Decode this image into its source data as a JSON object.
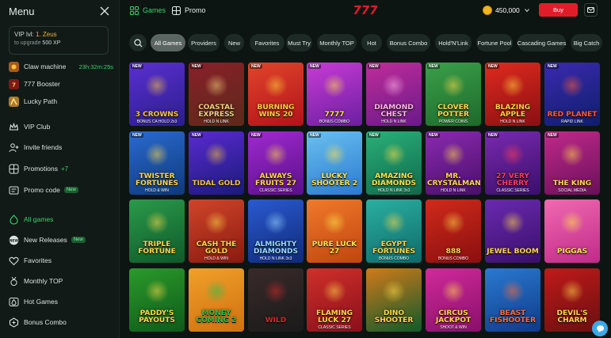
{
  "sidebar": {
    "menu_title": "Menu",
    "vip": {
      "label": "VIP lvl: ",
      "level": "1. Zeus",
      "upgrade_prefix": "to upgrade ",
      "upgrade_xp": "500 XP"
    },
    "items": [
      {
        "label": "Claw machine",
        "icon": "claw-machine-icon",
        "extra": "23h:32m:25s"
      },
      {
        "label": "777 Booster",
        "icon": "booster-icon"
      },
      {
        "label": "Lucky Path",
        "icon": "lucky-path-icon"
      },
      {
        "label": "VIP Club",
        "icon": "crown-icon"
      },
      {
        "label": "Invite friends",
        "icon": "invite-friends-icon"
      },
      {
        "label": "Promotions",
        "icon": "gift-icon",
        "extra": "+7"
      },
      {
        "label": "Promo code",
        "icon": "promo-code-icon",
        "extra": "New"
      },
      {
        "label": "All games",
        "icon": "all-games-icon"
      },
      {
        "label": "New Releases",
        "icon": "new-icon",
        "extra": "New"
      },
      {
        "label": "Favorites",
        "icon": "heart-icon"
      },
      {
        "label": "Monthly TOP",
        "icon": "medal-icon"
      },
      {
        "label": "Hot Games",
        "icon": "fire-icon"
      },
      {
        "label": "Bonus Combo",
        "icon": "bonus-combo-icon"
      }
    ]
  },
  "header": {
    "tabs": [
      {
        "label": "Games",
        "icon": "games-icon"
      },
      {
        "label": "Promo",
        "icon": "promo-icon"
      }
    ],
    "logo_text": "777",
    "balance": "450,000",
    "buy_label": "Buy"
  },
  "filters": [
    "All Games",
    "Providers",
    "New",
    "Favorites",
    "Must Try",
    "Monthly TOP",
    "Hot",
    "Bonus Combo",
    "Hold'N'Link",
    "Fortune Pool",
    "Cascading Games",
    "Big Catch"
  ],
  "games": [
    {
      "title": "3 CROWNS",
      "sub": "BONUS CA HOLD 2x3",
      "badge": "NEW",
      "bg1": "#2b1e8c",
      "bg2": "#5a2fd0",
      "accent": "#f5c542"
    },
    {
      "title": "COASTAL EXPRESS",
      "sub": "HOLD N LINK",
      "badge": "NEW",
      "bg1": "#5b2a1a",
      "bg2": "#8a1f2a",
      "accent": "#f0d07a"
    },
    {
      "title": "BURNING WINS 20",
      "sub": "",
      "badge": "NEW",
      "bg1": "#b3121a",
      "bg2": "#e0452a",
      "accent": "#ffd23a"
    },
    {
      "title": "7777",
      "sub": "BONUS COMBO",
      "badge": "NEW",
      "bg1": "#6a1fa0",
      "bg2": "#c93bd6",
      "accent": "#ffe14a"
    },
    {
      "title": "DIAMOND CHEST",
      "sub": "HOLD N LINK",
      "badge": "NEW",
      "bg1": "#6a1a8a",
      "bg2": "#c02c9a",
      "accent": "#ffb7e8"
    },
    {
      "title": "CLOVER POTTER",
      "sub": "POWER COINS",
      "badge": "NEW",
      "bg1": "#1e6a2a",
      "bg2": "#3aa04a",
      "accent": "#ffd94a"
    },
    {
      "title": "BLAZING APPLE",
      "sub": "HOLD N LINK",
      "badge": "NEW",
      "bg1": "#8a0f12",
      "bg2": "#e02a1f",
      "accent": "#ffd23a"
    },
    {
      "title": "RED PLANET",
      "sub": "RAPID LINK",
      "badge": "NEW",
      "bg1": "#0f1e6a",
      "bg2": "#3a2ab0",
      "accent": "#ff5a3a"
    },
    {
      "title": "TWISTER FORTUNES",
      "sub": "HOLD & WIN",
      "badge": "NEW",
      "bg1": "#0e3a7a",
      "bg2": "#2a6ad0",
      "accent": "#ffd84a"
    },
    {
      "title": "TIDAL GOLD",
      "sub": "",
      "badge": "NEW",
      "bg1": "#1a1a7a",
      "bg2": "#5a2ad0",
      "accent": "#f2c43a"
    },
    {
      "title": "ALWAYS FRUITS 27",
      "sub": "CLASSIC SERIES",
      "badge": "NEW",
      "bg1": "#5a0f8a",
      "bg2": "#a02ad0",
      "accent": "#ffd84a"
    },
    {
      "title": "LUCKY SHOOTER 2",
      "sub": "",
      "badge": "NEW",
      "bg1": "#2a7ad0",
      "bg2": "#6ac0f0",
      "accent": "#ffe04a"
    },
    {
      "title": "AMAZING DIAMONDS",
      "sub": "HOLD N LINK 3x3",
      "badge": "NEW",
      "bg1": "#0f6a4a",
      "bg2": "#2ab07a",
      "accent": "#ffe04a"
    },
    {
      "title": "MR. CRYSTALMAN",
      "sub": "HOLD N LINK",
      "badge": "NEW",
      "bg1": "#4a0f6a",
      "bg2": "#8a2ab0",
      "accent": "#ffd84a"
    },
    {
      "title": "27 VERY CHERRY",
      "sub": "CLASSIC SERIES",
      "badge": "NEW",
      "bg1": "#3a0f6a",
      "bg2": "#7a2ab0",
      "accent": "#ff3a5a"
    },
    {
      "title": "THE KING",
      "sub": "SOCIAL MEDIA",
      "badge": "NEW",
      "bg1": "#6a0f5a",
      "bg2": "#c02a8a",
      "accent": "#ffd84a"
    },
    {
      "title": "TRIPLE FORTUNE",
      "sub": "",
      "badge": "",
      "bg1": "#0f5a2a",
      "bg2": "#2a9a4a",
      "accent": "#ffd84a"
    },
    {
      "title": "CASH THE GOLD",
      "sub": "HOLD & WIN",
      "badge": "",
      "bg1": "#8a1a0f",
      "bg2": "#d0452a",
      "accent": "#ffd84a"
    },
    {
      "title": "ALMIGHTY DIAMONDS",
      "sub": "HOLD N LINK 3x3",
      "badge": "",
      "bg1": "#0f2a7a",
      "bg2": "#2a5ad0",
      "accent": "#9ad8ff"
    },
    {
      "title": "PURE LUCK 27",
      "sub": "",
      "badge": "",
      "bg1": "#c0450f",
      "bg2": "#f07a2a",
      "accent": "#ffe84a"
    },
    {
      "title": "EGYPT FORTUNES",
      "sub": "BONUS COMBO",
      "badge": "",
      "bg1": "#0f6a6a",
      "bg2": "#2ab0a0",
      "accent": "#ffd84a"
    },
    {
      "title": "888",
      "sub": "BONUS COMBO",
      "badge": "",
      "bg1": "#8a0f0f",
      "bg2": "#d02a1a",
      "accent": "#ffd84a"
    },
    {
      "title": "JEWEL BOOM",
      "sub": "",
      "badge": "",
      "bg1": "#3a0f6a",
      "bg2": "#6a2ab0",
      "accent": "#ffd84a"
    },
    {
      "title": "PIGGAS",
      "sub": "",
      "badge": "",
      "bg1": "#c02a8a",
      "bg2": "#f06ab0",
      "accent": "#ffe84a"
    },
    {
      "title": "PADDY'S PAYOUTS",
      "sub": "",
      "badge": "",
      "bg1": "#0f5a1a",
      "bg2": "#2a9a2a",
      "accent": "#ffd84a"
    },
    {
      "title": "MONEY COMING 2",
      "sub": "",
      "badge": "",
      "bg1": "#d0700f",
      "bg2": "#f0a02a",
      "accent": "#2ac04a"
    },
    {
      "title": "WILD",
      "sub": "",
      "badge": "",
      "bg1": "#1a1a1a",
      "bg2": "#3a2a2a",
      "accent": "#d02a2a"
    },
    {
      "title": "FLAMING LUCK 27",
      "sub": "CLASSIC SERIES",
      "badge": "",
      "bg1": "#8a0f1a",
      "bg2": "#d0302a",
      "accent": "#ffd84a"
    },
    {
      "title": "DINO SHOOTER",
      "sub": "",
      "badge": "",
      "bg1": "#0f5a2a",
      "bg2": "#d07a1a",
      "accent": "#ffd84a"
    },
    {
      "title": "CIRCUS JACKPOT",
      "sub": "SHOOT & WIN",
      "badge": "",
      "bg1": "#8a0f6a",
      "bg2": "#d02a9a",
      "accent": "#ffd84a"
    },
    {
      "title": "BEAST FISHOOTER",
      "sub": "",
      "badge": "",
      "bg1": "#0f3a8a",
      "bg2": "#2a7ad0",
      "accent": "#ff6a3a"
    },
    {
      "title": "DEVIL'S CHARM",
      "sub": "",
      "badge": "",
      "bg1": "#6a0f0f",
      "bg2": "#c01a1a",
      "accent": "#ffd84a"
    }
  ]
}
